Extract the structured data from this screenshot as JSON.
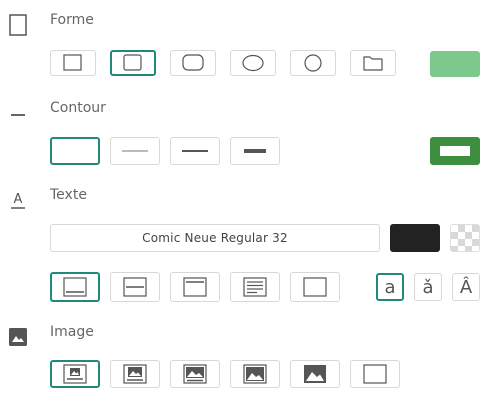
{
  "sections": {
    "shape": {
      "title": "Forme",
      "icon": "rectangle-outline-icon",
      "fill_color": "#7dc98b"
    },
    "outline": {
      "title": "Contour",
      "icon": "line-icon",
      "stroke_color": "#3d8f3f"
    },
    "text": {
      "title": "Texte",
      "icon": "text-format-icon",
      "font": "Comic Neue Regular 32",
      "text_color": "#222222",
      "background": "transparent-checker"
    },
    "image": {
      "title": "Image",
      "icon": "image-icon"
    }
  },
  "shape_options": [
    "square",
    "rounded-square",
    "rounded-rect",
    "ellipse",
    "circle",
    "folder"
  ],
  "outline_options": [
    "none",
    "thin",
    "medium",
    "thick"
  ],
  "text_positions": [
    "bottom",
    "middle",
    "top",
    "paragraph",
    "none"
  ],
  "text_case": [
    {
      "glyph": "a",
      "name": "lowercase"
    },
    {
      "glyph": "ǎ",
      "name": "accent"
    },
    {
      "glyph": "Â",
      "name": "uppercase-accent"
    }
  ],
  "image_sizes": [
    "small",
    "medium",
    "large",
    "larger",
    "full",
    "none"
  ],
  "accent_color": "#1f8a7c"
}
